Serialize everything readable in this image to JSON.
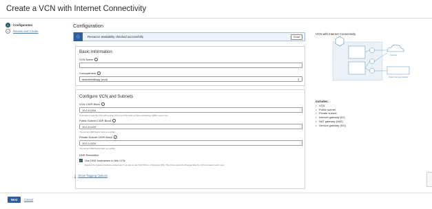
{
  "page": {
    "title": "Create a VCN with Internet Connectivity"
  },
  "steps": [
    {
      "number": "1",
      "label": "Configuration"
    },
    {
      "number": "2",
      "label": "Review and Create"
    }
  ],
  "main": {
    "title": "Configuration",
    "banner": {
      "icon": "info-icon",
      "message": "Resource availability checked successfully",
      "close_label": "Close"
    },
    "basic": {
      "heading": "Basic Information",
      "vcn_name_label": "VCN Name",
      "vcn_name_value": "",
      "compartment_label": "Compartment",
      "compartment_value": "sbshelbl/dbsgy (root)"
    },
    "vcn": {
      "heading": "Configure VCN and Subnets",
      "cidr_label": "VCN CIDR Block",
      "cidr_value": "10.0.0.0/16",
      "cidr_help": "If you plan to peer this VCN with another VCN, the VCNs must not have overlapping CIDRs.",
      "cidr_help_link": "Learn more",
      "public_label": "Public Subnet CIDR Block",
      "public_value": "10.0.0.0/24",
      "public_help": "The subnet CIDR blocks must not overlap.",
      "private_label": "Private Subnet CIDR Block",
      "private_value": "10.0.1.0/24",
      "private_help": "The subnet CIDR blocks must not overlap.",
      "dns_heading": "DNS Resolution",
      "dns_checkbox_label": "Use DNS hostnames in this VCN",
      "dns_help": "Required for instance hostname assignment if you plan to use VCN DNS or a third-party DNS. This choice cannot be changed after the VCN is created.",
      "dns_help_link": "Learn more"
    },
    "advanced_link": "Show Tagging Options"
  },
  "diagram": {
    "title": "VCN with Internet Connectivity",
    "labels": {
      "internet": "Internet",
      "service": "Oracle Services Network"
    }
  },
  "includes": {
    "heading": "Includes:",
    "items": [
      "VCN",
      "Public subnet",
      "Private subnet",
      "Internet gateway (IG)",
      "NAT gateway (NAT)",
      "Service gateway (SG)"
    ]
  },
  "footer": {
    "next_label": "Next",
    "cancel_label": "Cancel"
  },
  "colors": {
    "primary": "#2c5ea3",
    "active_step": "#2c5967",
    "link": "#4a7ba8"
  }
}
